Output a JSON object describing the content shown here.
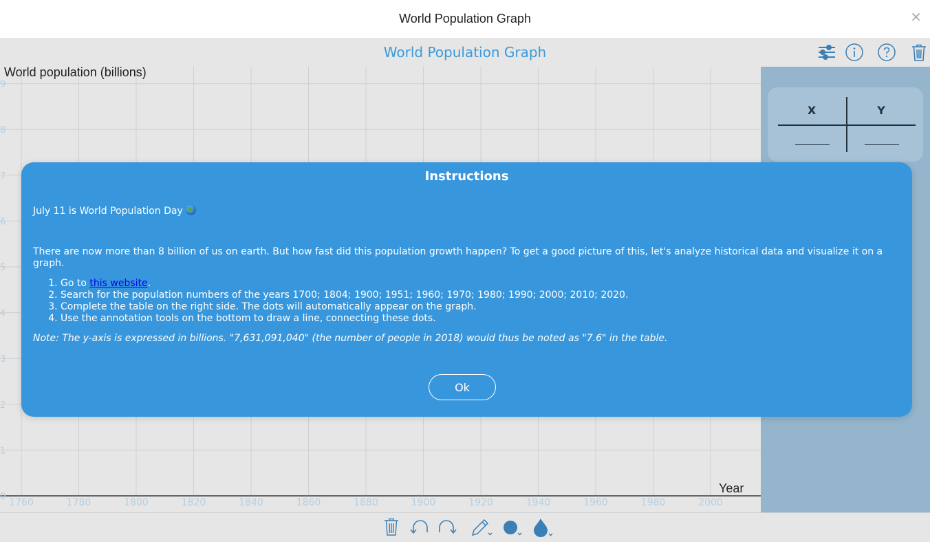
{
  "window": {
    "title": "World Population Graph",
    "close_glyph": "×"
  },
  "app": {
    "title": "World Population Graph",
    "header_icons": [
      "sliders-icon",
      "info-icon",
      "help-icon",
      "trash-icon"
    ]
  },
  "graph": {
    "y_axis_title": "World population (billions)",
    "x_axis_title": "Year",
    "x_ticks": [
      "1760",
      "1780",
      "1800",
      "1820",
      "1840",
      "1860",
      "1880",
      "1900",
      "1920",
      "1940",
      "1960",
      "1980",
      "2000",
      "2"
    ],
    "y_ticks": [
      "0",
      "1",
      "2",
      "3",
      "4",
      "5",
      "6",
      "7",
      "8",
      "9"
    ],
    "grid_color": "#d0d0d0",
    "tick_color": "#b4cfe3"
  },
  "table": {
    "x_header": "X",
    "y_header": "Y"
  },
  "toolbar": {
    "tools": [
      "trash-icon",
      "undo-icon",
      "redo-icon",
      "pen-icon",
      "dot-icon",
      "color-drop-icon"
    ],
    "accent": "#3a7fb5"
  },
  "instructions": {
    "title": "Instructions",
    "intro": "July 11 is World Population Day",
    "paragraph": "There are now more than 8 billion of us on earth. But how fast did this population growth happen? To get a good picture of this, let's analyze historical data and visualize it on a graph.",
    "step1_prefix": "Go to ",
    "step1_link": "this website",
    "step1_suffix": ".",
    "step2": "Search for the population numbers of the years 1700; 1804; 1900; 1951; 1960; 1970; 1980; 1990; 2000; 2010; 2020.",
    "step3": "Complete the table on the right side. The dots will automatically appear on the graph.",
    "step4": "Use the annotation tools on the bottom to draw a line, connecting these dots.",
    "note": "Note: The y-axis is expressed in billions. \"7,631,091,040\" (the number of people in 2018) would thus be noted as \"7.6\" in the table.",
    "ok_label": "Ok",
    "background": "#3897dc"
  }
}
